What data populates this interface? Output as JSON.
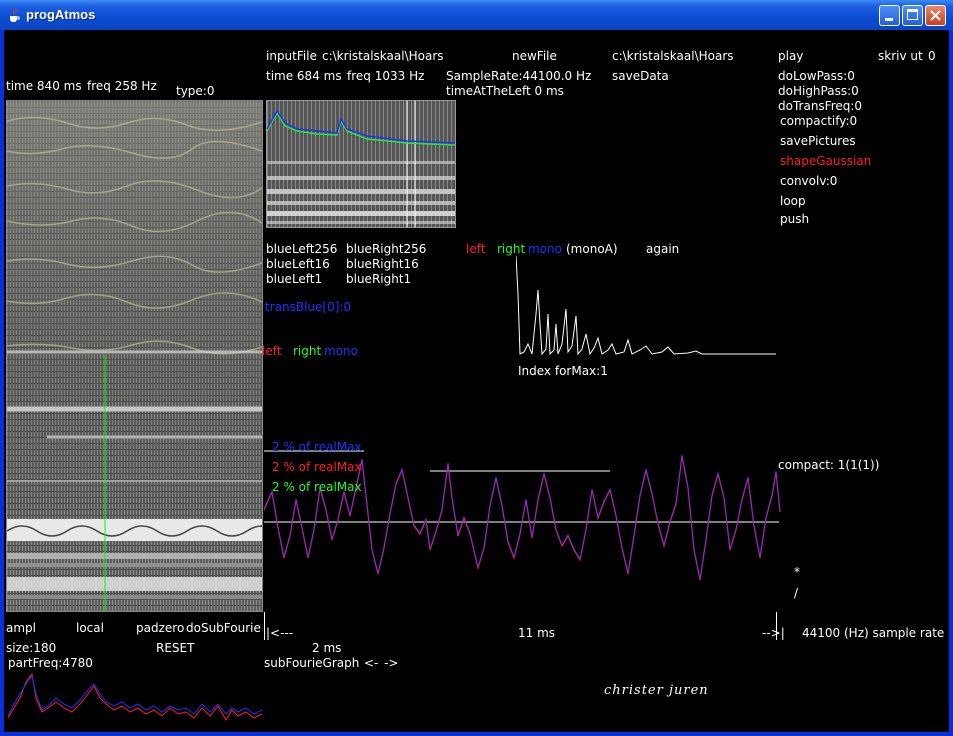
{
  "window": {
    "title": "progAtmos"
  },
  "left_panel": {
    "time_label": "time  840 ms",
    "freq_label": "freq  258 Hz",
    "type_label": "type:0",
    "ampl": "ampl",
    "local": "local",
    "padzero": "padzero",
    "dosubfourie": "doSubFourie",
    "size": "size:180",
    "reset": "RESET",
    "partfreq": "partFreq:4780"
  },
  "top": {
    "inputfile": "inputFile",
    "inputfile_path": "c:\\kristalskaal\\Hoars",
    "newfile": "newFile",
    "newfile_path": "c:\\kristalskaal\\Hoars",
    "time2": "time  684 ms",
    "freq2": "freq  1033 Hz",
    "samplerate": "SampleRate:44100.0 Hz",
    "timeattheleft": "timeAtTheLeft  0 ms",
    "savedata": "saveData"
  },
  "right_panel": {
    "play": "play",
    "skrivut": "skriv ut",
    "skrivut_value": "0",
    "dolowpass": "doLowPass:0",
    "dohighpass": "doHighPass:0",
    "dotransfreq": "doTransFreq:0",
    "compactify": "compactify:0",
    "savepictures": "savePictures",
    "shapegaussian": "shapeGaussian",
    "convolv": "convolv:0",
    "loop": "loop",
    "push": "push",
    "compact": "compact: 1(1(1))",
    "star": "*",
    "slash": "/"
  },
  "mid": {
    "blueleft256": "blueLeft256",
    "blueright256": "blueRight256",
    "blueleft16": "blueLeft16",
    "blueright16": "blueRight16",
    "blueleft1": "blueLeft1",
    "blueright1": "blueRight1",
    "transblue": "transBlue[0]:0",
    "left": "left",
    "right": "right",
    "mono": "mono",
    "left2": "left",
    "right2": "right",
    "mono2": "mono",
    "monoA": "(monoA)",
    "again": "again",
    "indexformax": "Index forMax:1",
    "pct_blue": "2 % of realMax",
    "pct_red": "2 % of realMax",
    "pct_green": "2 % of realMax"
  },
  "bottom": {
    "arrow_left": "|<---",
    "ms11": "11 ms",
    "arrow_right": "-->|",
    "samplerate_hint": "44100 (Hz) sample rate",
    "ms2": "2 ms",
    "subfouriegraph": "subFourieGraph",
    "back": "<-",
    "fwd": "->",
    "signature": "christer  juren"
  },
  "colors": {
    "left": "#ff2020",
    "right": "#20ff20",
    "mono": "#2030ff",
    "shape": "#ff2020"
  }
}
